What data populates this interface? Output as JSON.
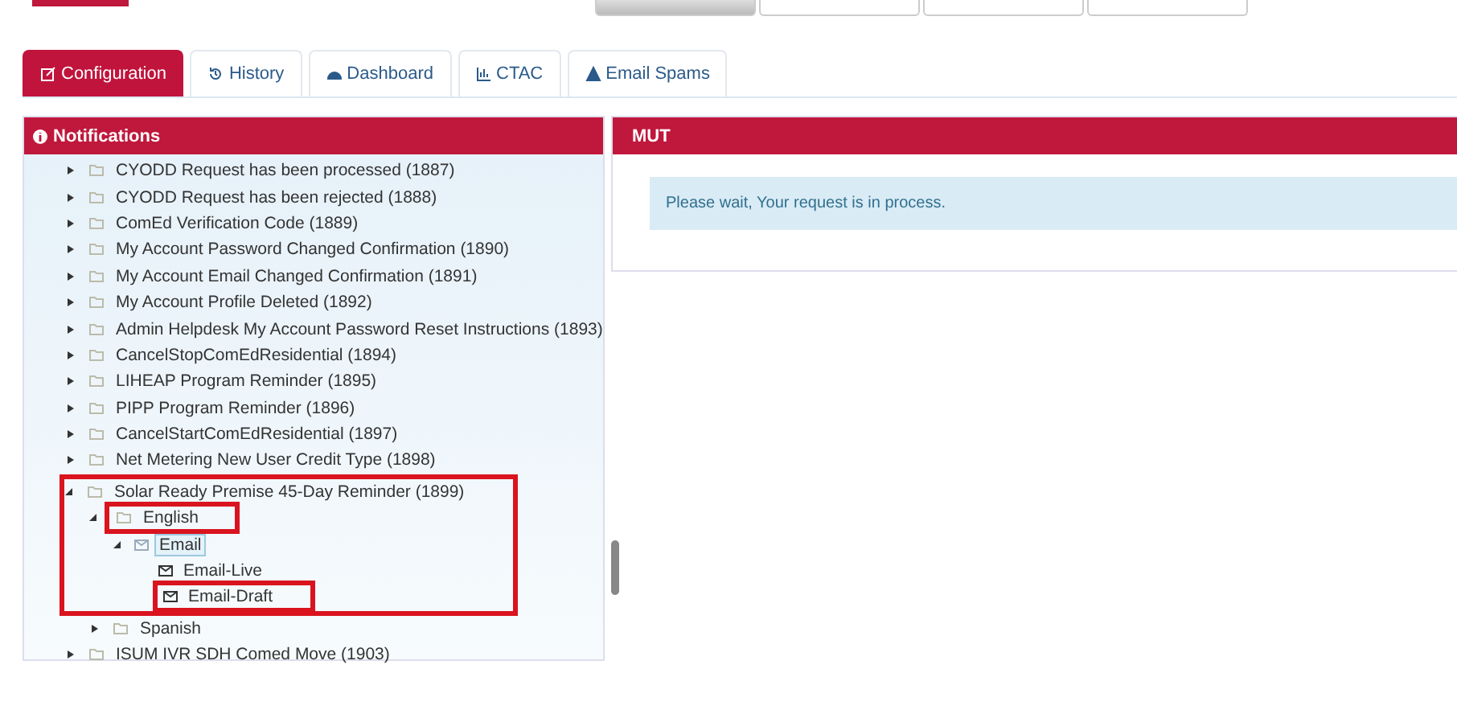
{
  "top_buttons": [
    {
      "selected": true
    },
    {
      "selected": false
    },
    {
      "selected": false
    },
    {
      "selected": false
    }
  ],
  "tabs": [
    {
      "label": "Configuration",
      "selected": true
    },
    {
      "label": "History",
      "selected": false
    },
    {
      "label": "Dashboard",
      "selected": false
    },
    {
      "label": "CTAC",
      "selected": false
    },
    {
      "label": "Email Spams",
      "selected": false
    }
  ],
  "notifications": {
    "title": "Notifications",
    "tree": [
      {
        "label": "CYODD Request has been processed (1887)",
        "kind": "folder",
        "expanded": false
      },
      {
        "label": "CYODD Request has been rejected (1888)",
        "kind": "folder",
        "expanded": false
      },
      {
        "label": "ComEd Verification Code (1889)",
        "kind": "folder",
        "expanded": false
      },
      {
        "label": "My Account Password Changed Confirmation (1890)",
        "kind": "folder",
        "expanded": false
      },
      {
        "label": "My Account Email Changed Confirmation (1891)",
        "kind": "folder",
        "expanded": false
      },
      {
        "label": "My Account Profile Deleted (1892)",
        "kind": "folder",
        "expanded": false
      },
      {
        "label": "Admin Helpdesk My Account Password Reset Instructions (1893)",
        "kind": "folder",
        "expanded": false
      },
      {
        "label": "CancelStopComEdResidential (1894)",
        "kind": "folder",
        "expanded": false
      },
      {
        "label": "LIHEAP Program Reminder (1895)",
        "kind": "folder",
        "expanded": false
      },
      {
        "label": "PIPP Program Reminder (1896)",
        "kind": "folder",
        "expanded": false
      },
      {
        "label": "CancelStartComEdResidential (1897)",
        "kind": "folder",
        "expanded": false
      },
      {
        "label": "Net Metering New User Credit Type (1898)",
        "kind": "folder",
        "expanded": false
      },
      {
        "label": "Solar Ready Premise 45-Day Reminder (1899)",
        "kind": "folder",
        "expanded": true,
        "annotated_group": true,
        "children": [
          {
            "label": "English",
            "kind": "folder",
            "expanded": true,
            "annotated": true,
            "children": [
              {
                "label": "Email",
                "kind": "email_folder",
                "expanded": true,
                "selected": true,
                "children": [
                  {
                    "label": "Email-Live",
                    "kind": "email",
                    "selected": false
                  },
                  {
                    "label": "Email-Draft",
                    "kind": "email",
                    "selected": false,
                    "annotated": true
                  }
                ]
              }
            ]
          },
          {
            "label": "Spanish",
            "kind": "folder",
            "expanded": false
          }
        ]
      },
      {
        "label": "ISUM IVR SDH Comed Move (1903)",
        "kind": "folder",
        "expanded": false
      }
    ]
  },
  "detail": {
    "title": "MUT",
    "message": "Please wait, Your request is in process."
  }
}
